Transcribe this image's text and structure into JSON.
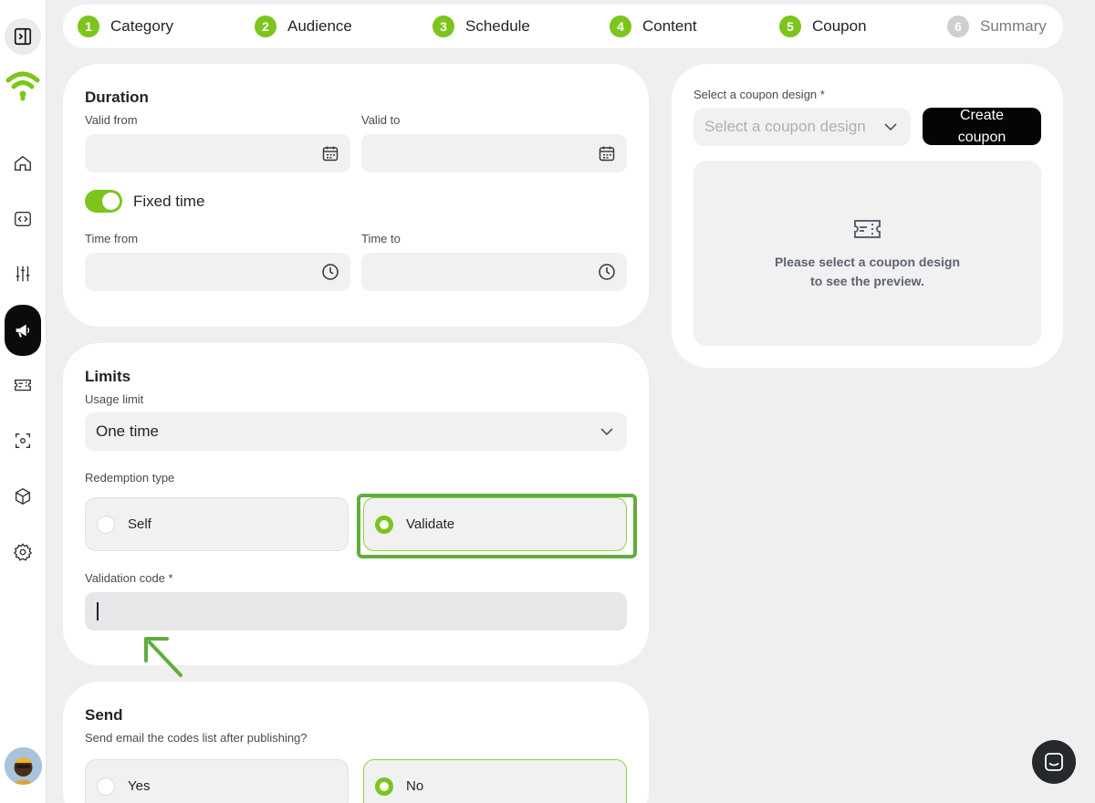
{
  "stepper": {
    "steps": [
      {
        "num": "1",
        "label": "Category"
      },
      {
        "num": "2",
        "label": "Audience"
      },
      {
        "num": "3",
        "label": "Schedule"
      },
      {
        "num": "4",
        "label": "Content"
      },
      {
        "num": "5",
        "label": "Coupon"
      },
      {
        "num": "6",
        "label": "Summary"
      }
    ]
  },
  "duration": {
    "title": "Duration",
    "valid_from_label": "Valid from",
    "valid_to_label": "Valid to",
    "fixed_time_label": "Fixed time",
    "fixed_time_on": true,
    "time_from_label": "Time from",
    "time_to_label": "Time to"
  },
  "limits": {
    "title": "Limits",
    "usage_limit_label": "Usage limit",
    "usage_limit_value": "One time",
    "redemption_type_label": "Redemption type",
    "redemption_options": [
      {
        "label": "Self",
        "selected": false
      },
      {
        "label": "Validate",
        "selected": true
      }
    ],
    "validation_code_label": "Validation code *",
    "validation_code_value": ""
  },
  "send": {
    "title": "Send",
    "question": "Send email the codes list after publishing?",
    "options": [
      {
        "label": "Yes",
        "selected": false
      },
      {
        "label": "No",
        "selected": true
      }
    ]
  },
  "coupon": {
    "design_label": "Select a coupon design *",
    "design_placeholder": "Select a coupon design",
    "create_button": "Create coupon",
    "preview_line1": "Please select a coupon design",
    "preview_line2": "to see the preview."
  },
  "colors": {
    "accent": "#7cc51c",
    "dark": "#0b0b0b",
    "highlight": "#5fae3b"
  },
  "icons": {
    "sidebar": [
      "sidebar-toggle-icon",
      "wifi-logo-icon",
      "home-icon",
      "code-icon",
      "sliders-icon",
      "megaphone-icon",
      "ticket-icon",
      "scan-icon",
      "box-icon",
      "gear-icon"
    ]
  }
}
